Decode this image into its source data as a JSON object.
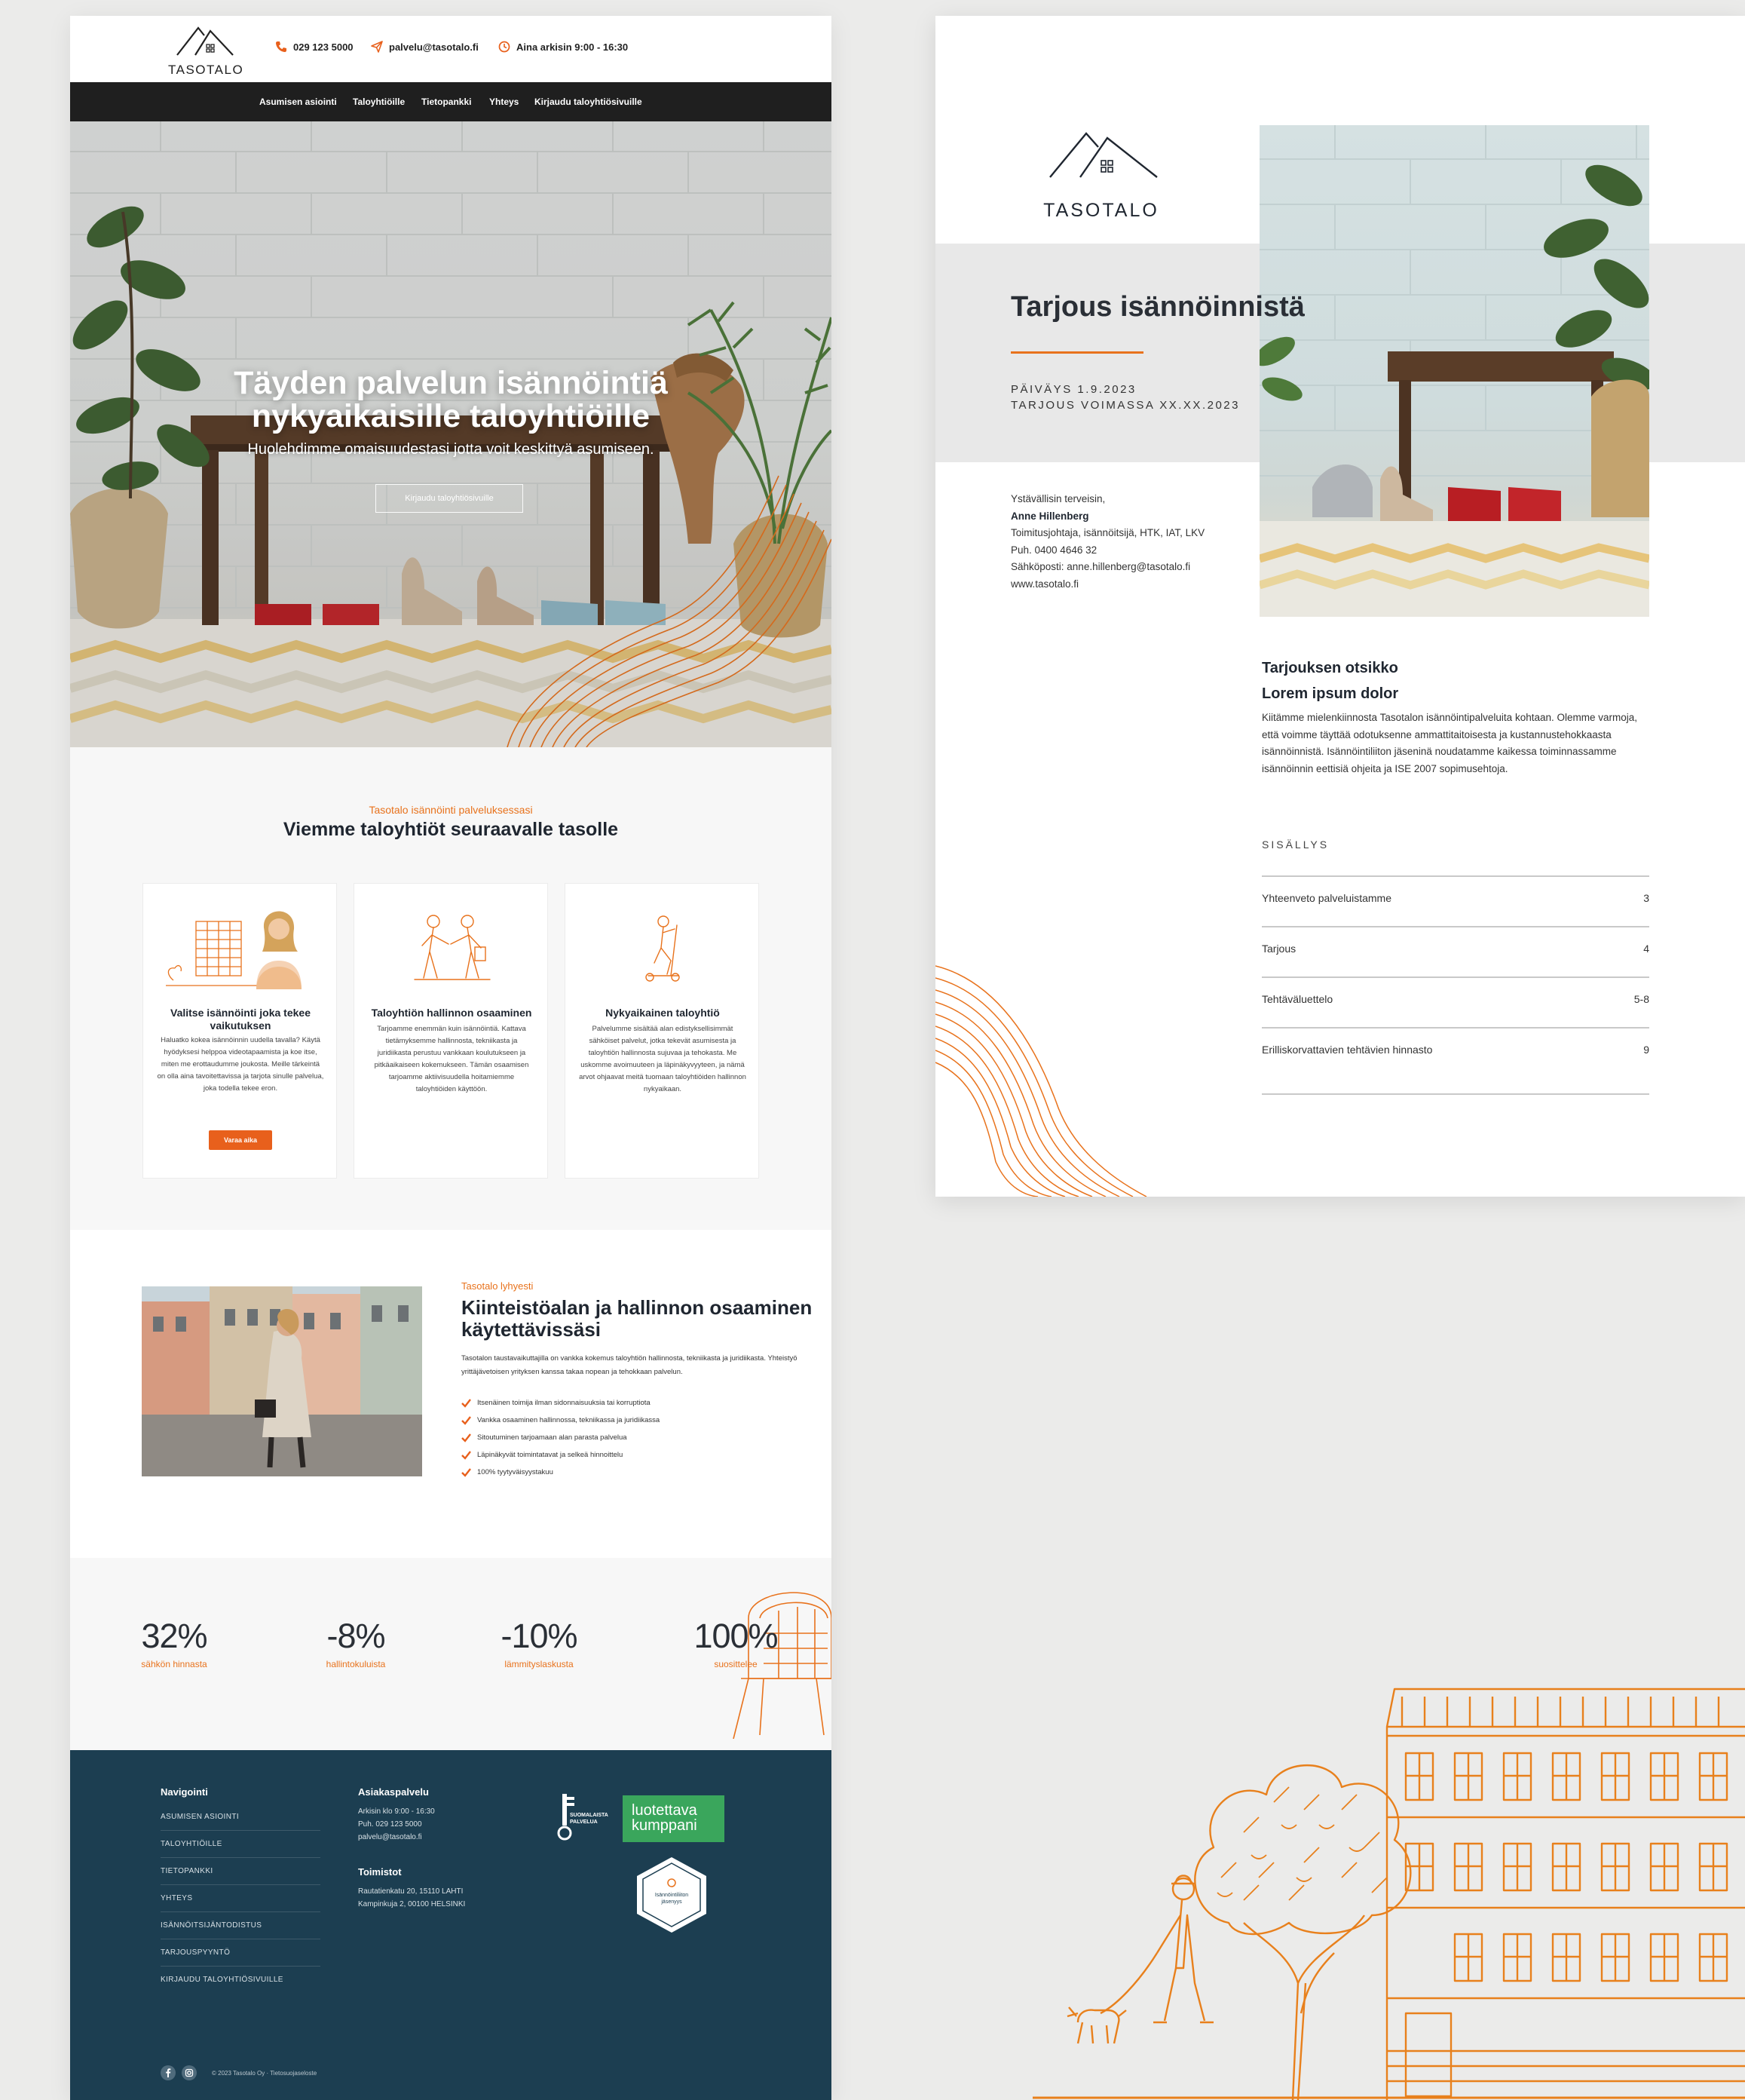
{
  "site": {
    "logo_text": "TASOTALO",
    "phone": "029 123 5000",
    "email": "palvelu@tasotalo.fi",
    "hours": "Aina arkisin 9:00 - 16:30",
    "nav": [
      "Asumisen asiointi",
      "Taloyhtiöille",
      "Tietopankki",
      "Yhteys",
      "Kirjaudu taloyhtiösivuille"
    ],
    "hero": {
      "title_line1": "Täyden palvelun isännöintiä",
      "title_line2": "nykyaikaisille taloyhtiöille",
      "subtitle": "Huolehdimme omaisuudestasi jotta voit keskittyä asumiseen.",
      "button": "Kirjaudu taloyhtiösivuille"
    },
    "services": {
      "eyebrow": "Tasotalo isännöinti palveluksessasi",
      "title": "Viemme taloyhtiöt seuraavalle tasolle",
      "cards": [
        {
          "title": "Valitse isännöinti joka tekee vaikutuksen",
          "text": "Haluatko kokea isännöinnin uudella tavalla? Käytä hyödyksesi helppoa videotapaamista ja koe itse, miten me erottaudumme joukosta. Meille tärkeintä on olla aina tavoitettavissa ja tarjota sinulle palvelua, joka todella tekee eron.",
          "button": "Varaa aika"
        },
        {
          "title": "Taloyhtiön hallinnon osaaminen",
          "text": "Tarjoamme enemmän kuin isännöintiä. Kattava tietämyksemme hallinnosta, tekniikasta ja juridiikasta perustuu vankkaan koulutukseen ja pitkäaikaiseen kokemukseen. Tämän osaamisen tarjoamme aktiivisuudella hoitamiemme taloyhtiöiden käyttöön."
        },
        {
          "title": "Nykyaikainen taloyhtiö",
          "text": "Palvelumme sisältää alan edistyksellisimmät sähköiset palvelut, jotka tekevät asumisesta ja taloyhtiön hallinnosta sujuvaa ja tehokasta. Me uskomme avoimuuteen ja läpinäkyvyyteen, ja nämä arvot ohjaavat meitä tuomaan taloyhtiöiden hallinnon nykyaikaan."
        }
      ]
    },
    "about": {
      "eyebrow": "Tasotalo lyhyesti",
      "title": "Kiinteistöalan ja hallinnon osaaminen käytettävissäsi",
      "lead": "Tasotalon taustavaikuttajilla on vankka kokemus taloyhtiön hallinnosta, tekniikasta ja juridiikasta. Yhteistyö yrittäjävetoisen yrityksen kanssa takaa nopean ja tehokkaan palvelun.",
      "checks": [
        "Itsenäinen toimija ilman sidonnaisuuksia tai korruptiota",
        "Vankka osaaminen hallinnossa, tekniikassa ja juridiikassa",
        "Sitoutuminen tarjoamaan alan parasta palvelua",
        "Läpinäkyvät toimintatavat ja selkeä hinnoittelu",
        "100% tyytyväisyystakuu"
      ]
    },
    "stats": [
      {
        "value": "32%",
        "label": "sähkön hinnasta"
      },
      {
        "value": "-8%",
        "label": "hallintokuluista"
      },
      {
        "value": "-10%",
        "label": "lämmityslaskusta"
      },
      {
        "value": "100%",
        "label": "suosittelee"
      }
    ],
    "footer": {
      "nav_title": "Navigointi",
      "nav_links": [
        "ASUMISEN ASIOINTI",
        "TALOYHTIÖILLE",
        "TIETOPANKKI",
        "YHTEYS",
        "ISÄNNÖITSIJÄNTODISTUS",
        "TARJOUSPYYNTÖ",
        "KIRJAUDU TALOYHTIÖSIVUILLE"
      ],
      "service_title": "Asiakaspalvelu",
      "service_lines": [
        "Arkisin klo 9:00 - 16:30",
        "Puh. 029 123 5000",
        "palvelu@tasotalo.fi"
      ],
      "offices_title": "Toimistot",
      "office_lines": [
        "Rautatienkatu 20, 15110 LAHTI",
        "Kampinkuja 2, 00100 HELSINKI"
      ],
      "badge_finnish": "SUOMALAISTA PALVELUA",
      "badge_trust_line1": "luotettava",
      "badge_trust_line2": "kumppani",
      "badge_hex": "Isännöintiliiton jäsenyys",
      "copyright": "© 2023 Tasotalo Oy · Tietosuojaseloste"
    }
  },
  "document": {
    "logo_text": "TASOTALO",
    "title": "Tarjous isännöinnistä",
    "date_line": "PÄIVÄYS 1.9.2023",
    "valid_line": "TARJOUS VOIMASSA XX.XX.2023",
    "signature": [
      "Ystävällisin terveisin,",
      "Anne Hillenberg",
      "Toimitusjohtaja, isännöitsijä, HTK, IAT, LKV",
      "Puh. 0400 4646 32",
      "Sähköposti: anne.hillenberg@tasotalo.fi",
      "www.tasotalo.fi"
    ],
    "section_title_line1": "Tarjouksen otsikko",
    "section_title_line2": "Lorem ipsum dolor",
    "body": "Kiitämme mielenkiinnosta Tasotalon isännöintipalveluita kohtaan. Olemme varmoja, että voimme täyttää odotuksenne ammattitaitoisesta ja kustannustehokkaasta isännöinnistä. Isännöintiliiton jäseninä noudatamme kaikessa toiminnassamme isännöinnin eettisiä ohjeita ja ISE 2007 sopimusehtoja.",
    "toc_title": "SISÄLLYS",
    "toc": [
      {
        "title": "Yhteenveto palveluistamme",
        "page": "3"
      },
      {
        "title": "Tarjous",
        "page": "4"
      },
      {
        "title": "Tehtäväluettelo",
        "page": "5-8"
      },
      {
        "title": "Erilliskorvattavien tehtävien hinnasto",
        "page": "9"
      }
    ]
  },
  "colors": {
    "accent": "#e8721c",
    "nav_bg": "#1f1f1f",
    "footer_bg": "#1c3e51",
    "background": "#ebebea",
    "trust_badge": "#3aa65c"
  },
  "icons": [
    "phone-icon",
    "send-icon",
    "clock-icon",
    "check-icon",
    "facebook-icon",
    "instagram-icon",
    "roof-logo-icon"
  ]
}
